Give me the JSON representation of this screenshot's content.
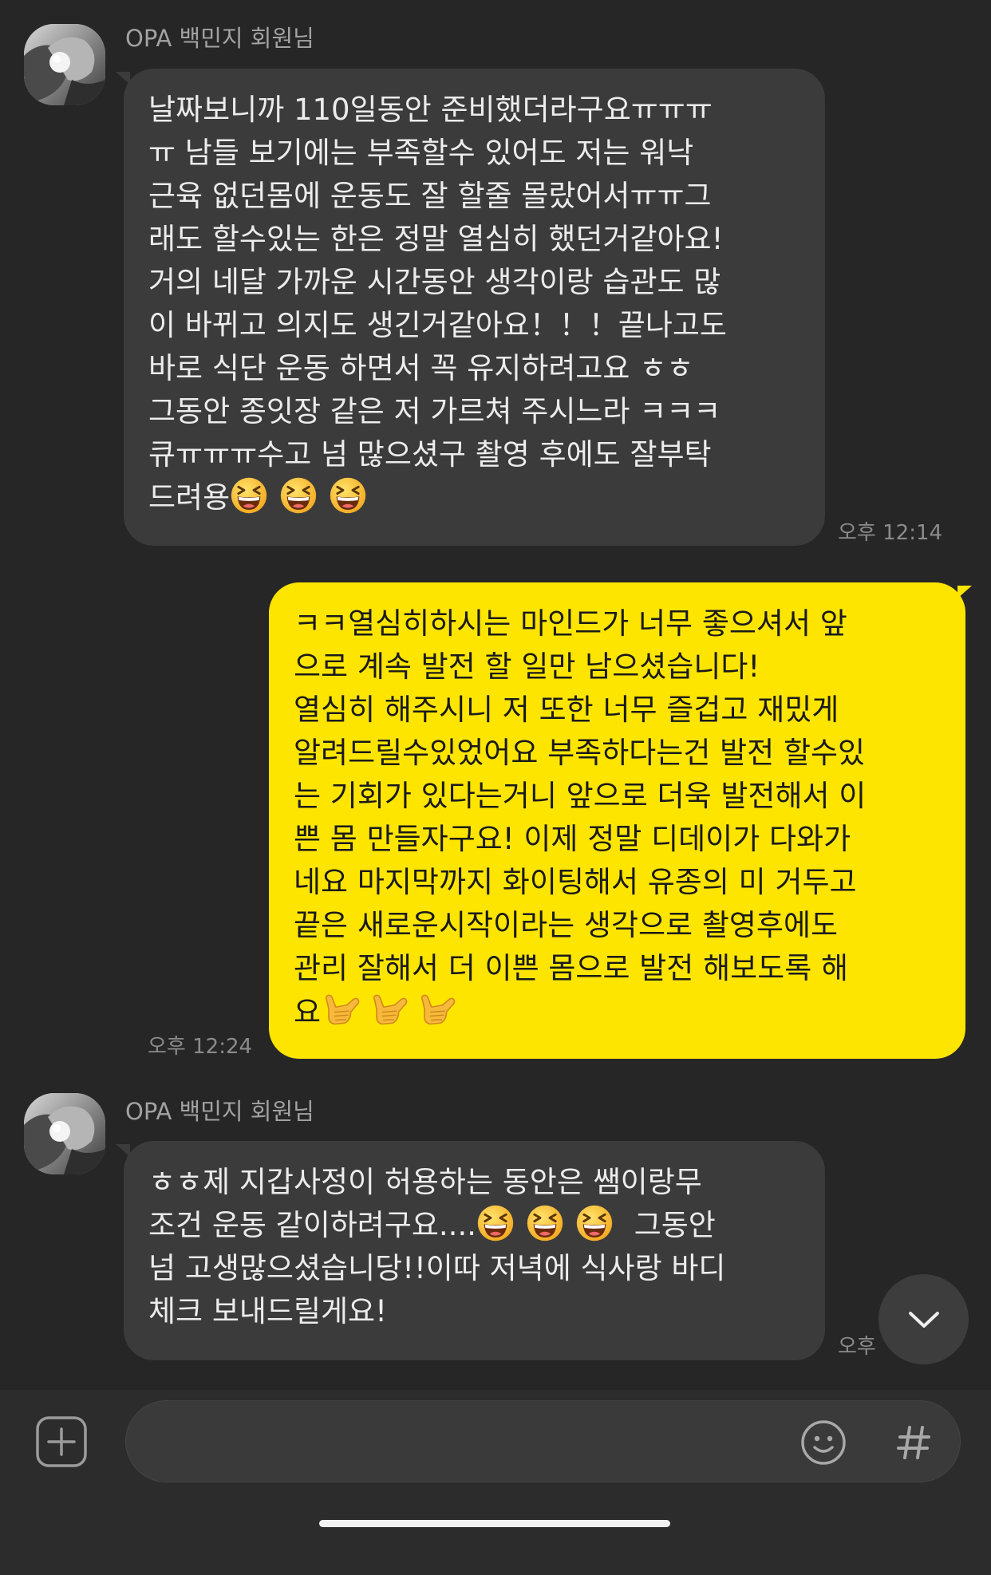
{
  "chat": {
    "messages": [
      {
        "direction": "received",
        "sender_name": "OPA 백민지 회원님",
        "avatar": "member-avatar",
        "time": "오후 12:14",
        "lines": [
          {
            "text": "날짜보니까 110일동안 준비했더라구요ㅠㅠㅠ"
          },
          {
            "text": "ㅠ 남들 보기에는 부족할수 있어도 저는 워낙"
          },
          {
            "text": "근육 없던몸에 운동도 잘 할줄 몰랐어서ㅠㅠ그"
          },
          {
            "text": "래도 할수있는 한은 정말 열심히 했던거같아요!"
          },
          {
            "text": "거의 네달 가까운 시간동안 생각이랑 습관도 많"
          },
          {
            "text": "이 바뀌고 의지도 생긴거같아요！！！끝나고도"
          },
          {
            "text": "바로 식단 운동 하면서 꼭 유지하려고요 ㅎㅎ"
          },
          {
            "text": "그동안 종잇장 같은 저 가르쳐 주시느라 ㅋㅋㅋ"
          },
          {
            "text": "큐ㅠㅠㅠ수고 넘 많으셨구 촬영 후에도 잘부탁"
          },
          {
            "text": "드려용",
            "emoji": "laughing-face-icon",
            "emoji_count": 3
          }
        ]
      },
      {
        "direction": "sent",
        "time": "오후 12:24",
        "lines": [
          {
            "text": "ㅋㅋ열심히하시는 마인드가 너무 좋으셔서 앞"
          },
          {
            "text": "으로 계속 발전 할 일만 남으셨습니다!"
          },
          {
            "text": "열심히 해주시니 저 또한 너무 즐겁고 재밌게"
          },
          {
            "text": "알려드릴수있었어요 부족하다는건 발전 할수있"
          },
          {
            "text": "는 기회가 있다는거니 앞으로 더욱 발전해서 이"
          },
          {
            "text": "쁜 몸 만들자구요! 이제 정말 디데이가 다와가"
          },
          {
            "text": "네요 마지막까지 화이팅해서 유종의 미 거두고"
          },
          {
            "text": "끝은 새로운시작이라는 생각으로 촬영후에도"
          },
          {
            "text": "관리 잘해서 더 이쁜 몸으로 발전 해보도록 해"
          },
          {
            "text": "요",
            "emoji": "call-me-hand-icon",
            "emoji_count": 3
          }
        ]
      },
      {
        "direction": "received",
        "sender_name": "OPA 백민지 회원님",
        "avatar": "member-avatar",
        "time": "오후",
        "lines": [
          {
            "text": "ㅎㅎ제 지갑사정이 허용하는 동안은 쌤이랑무"
          },
          {
            "text": "조건 운동 같이하려구요....",
            "emoji": "laughing-face-icon",
            "emoji_count": 3,
            "text_after": " 그동안"
          },
          {
            "text": "넘 고생많으셨습니당!!이따 저녁에 식사랑 바디"
          },
          {
            "text": "체크 보내드릴게요!"
          }
        ]
      }
    ]
  },
  "scroll_button": {
    "icon": "chevron-down-icon"
  },
  "composer": {
    "attach_icon": "plus-icon",
    "input_value": "",
    "emoticon_icon": "emoticon-icon",
    "hashtag_icon": "hashtag-icon"
  },
  "colors": {
    "background": "#262626",
    "received_bubble": "#3b3b3b",
    "sent_bubble": "#fee500",
    "timestamp": "#8b8b8b"
  }
}
